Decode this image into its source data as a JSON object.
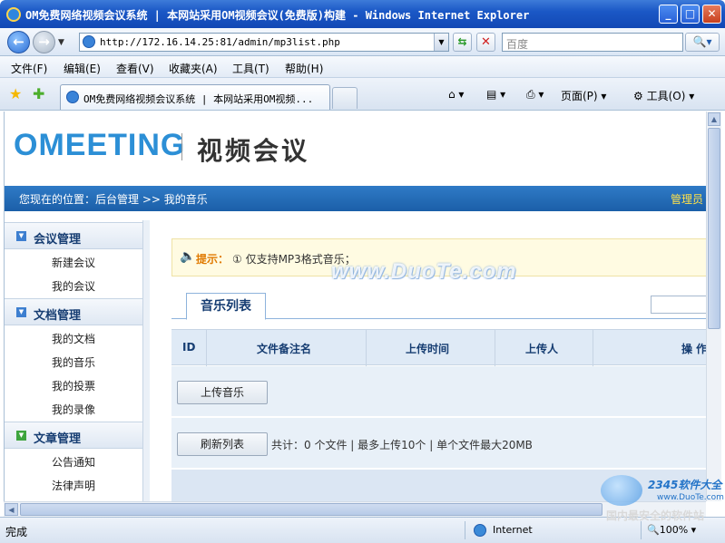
{
  "window": {
    "title": "OM免费网络视频会议系统 | 本网站采用OM视频会议(免费版)构建 - Windows Internet Explorer",
    "minimize_glyph": "_",
    "maximize_glyph": "□",
    "close_glyph": "✕"
  },
  "address_bar": {
    "back_glyph": "←",
    "forward_glyph": "→",
    "dropdown_glyph": "▼",
    "url": "http://172.16.14.25:81/admin/mp3list.php",
    "refresh_glyph": "⇆",
    "stop_glyph": "✕",
    "search_placeholder": "百度",
    "search_glyph": "🔍▾"
  },
  "menu": {
    "items": [
      "文件(F)",
      "编辑(E)",
      "查看(V)",
      "收藏夹(A)",
      "工具(T)",
      "帮助(H)"
    ]
  },
  "favorites_bar": {
    "star_glyph": "★",
    "add_glyph": "✚",
    "tab_label": "OM免费网络视频会议系统 | 本网站采用OM视频...",
    "home": "⌂ ▾",
    "feed": "▤ ▾",
    "print": "⎙ ▾",
    "page": "页面(P) ▾",
    "tools": "⚙ 工具(O) ▾"
  },
  "header": {
    "logo": "OMEETING",
    "logo_sub": "视频会议"
  },
  "breadcrumb": {
    "text": "您现在的位置：后台管理 >> 我的音乐",
    "admin": "管理员"
  },
  "sidebar": {
    "groups": [
      {
        "label": "会议管理",
        "icon": "▼",
        "items": [
          "新建会议",
          "我的会议"
        ]
      },
      {
        "label": "文档管理",
        "icon": "▼",
        "items": [
          "我的文档",
          "我的音乐",
          "我的投票",
          "我的录像"
        ]
      },
      {
        "label": "文章管理",
        "icon": "▼",
        "items": [
          "公告通知",
          "法律声明"
        ]
      }
    ]
  },
  "tip": {
    "icon": "🔈",
    "label": "提示：",
    "text": "① 仅支持MP3格式音乐；"
  },
  "tab": {
    "label": "音乐列表"
  },
  "grid": {
    "columns": [
      "ID",
      "文件备注名",
      "上传时间",
      "上传人",
      "操 作"
    ]
  },
  "actions": {
    "upload": "上传音乐",
    "refresh": "刷新列表",
    "count_text": "共计：0 个文件 | 最多上传10个 | 单个文件最大20MB"
  },
  "watermark": "www.DuoTe.com",
  "status": {
    "done": "完成",
    "zone": "Internet",
    "zoom": "🔍100% ▾"
  },
  "brand": {
    "name": "2345软件大全",
    "url": "www.DuoTe.com",
    "slogan": "国内最安全的软件站"
  },
  "scroll": {
    "up": "▲",
    "left": "◀"
  }
}
